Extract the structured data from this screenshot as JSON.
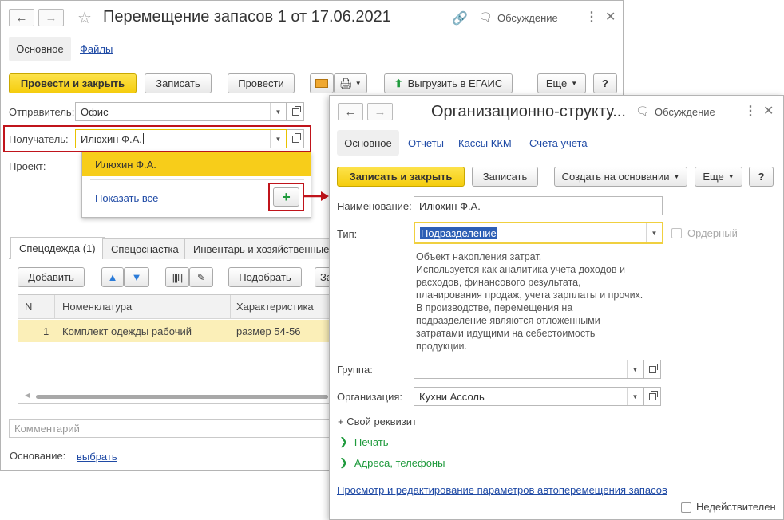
{
  "main": {
    "title": "Перемещение запасов 1 от 17.06.2021",
    "discussion": "Обсуждение",
    "tabs": [
      "Основное",
      "Файлы"
    ],
    "toolbar": {
      "post_close": "Провести и закрыть",
      "save": "Записать",
      "post": "Провести",
      "export": "Выгрузить в ЕГАИС",
      "more": "Еще",
      "help": "?"
    },
    "sender_label": "Отправитель:",
    "sender_value": "Офис",
    "recipient_label": "Получатель:",
    "recipient_value": "Илюхин Ф.А.",
    "project_label": "Проект:",
    "dropdown": {
      "item": "Илюхин Ф.А.",
      "show_all": "Показать все"
    },
    "inner_tabs": [
      "Спецодежда (1)",
      "Спецоснастка",
      "Инвентарь и хозяйственные"
    ],
    "table_toolbar": {
      "add": "Добавить",
      "pick": "Подобрать",
      "cut_label": "За"
    },
    "table": {
      "headers": [
        "N",
        "Номенклатура",
        "Характеристика"
      ],
      "rows": [
        {
          "n": "1",
          "item": "Комплект одежды рабочий",
          "char": "размер 54-56"
        }
      ]
    },
    "comment_placeholder": "Комментарий",
    "basis_label": "Основание:",
    "basis_link": "выбрать"
  },
  "dialog": {
    "title": "Организационно-структу...",
    "discussion": "Обсуждение",
    "tabs": [
      "Основное",
      "Отчеты",
      "Кассы ККМ",
      "Счета учета"
    ],
    "toolbar": {
      "save_close": "Записать и закрыть",
      "save": "Записать",
      "create_based": "Создать на основании",
      "more": "Еще",
      "help": "?"
    },
    "name_label": "Наименование:",
    "name_value": "Илюхин Ф.А.",
    "type_label": "Тип:",
    "type_value": "Подразделение",
    "ordered_label": "Ордерный",
    "description": [
      "Объект накопления затрат.",
      "Используется как аналитика учета доходов и",
      "расходов, финансового результата,",
      "планирования продаж, учета зарплаты и прочих.",
      "В производстве, перемещения на",
      "подразделение являются отложенными",
      "затратами идущими на себестоимость",
      "продукции."
    ],
    "group_label": "Группа:",
    "group_value": "",
    "org_label": "Организация:",
    "org_value": "Кухни Ассоль",
    "custom_prop": "+ Свой реквизит",
    "print": "Печать",
    "addresses": "Адреса, телефоны",
    "link_bottom": "Просмотр и редактирование параметров автоперемещения запасов",
    "inactive_label": "Недействителен"
  },
  "colors": {
    "accent_yellow": "#f5cd0e",
    "red_highlight": "#c0141b",
    "link_blue": "#1f4aa5",
    "green": "#1e9a3c"
  }
}
